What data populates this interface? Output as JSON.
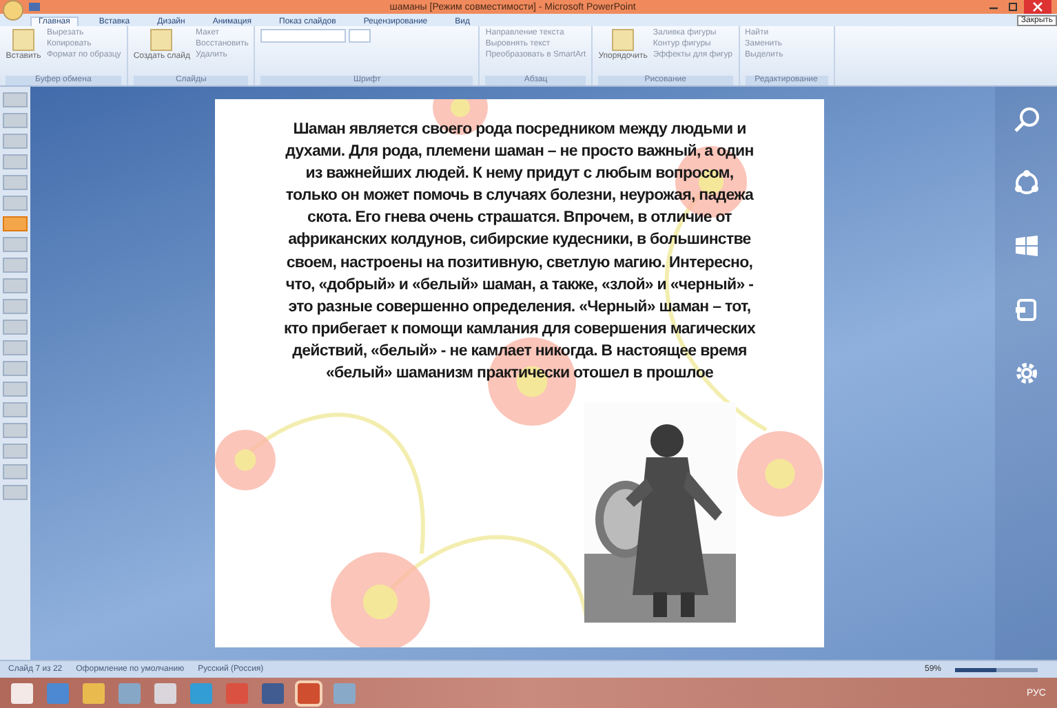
{
  "window": {
    "title": "шаманы [Режим совместимости] - Microsoft PowerPoint",
    "tooltip": "Закрыть"
  },
  "ribbon": {
    "tabs": [
      {
        "label": "Главная",
        "selected": true
      },
      {
        "label": "Вставка",
        "selected": false
      },
      {
        "label": "Дизайн",
        "selected": false
      },
      {
        "label": "Анимация",
        "selected": false
      },
      {
        "label": "Показ слайдов",
        "selected": false
      },
      {
        "label": "Рецензирование",
        "selected": false
      },
      {
        "label": "Вид",
        "selected": false
      }
    ],
    "groups": [
      {
        "name": "Буфер обмена",
        "big": "Вставить",
        "items": [
          "Вырезать",
          "Копировать",
          "Формат по образцу"
        ]
      },
      {
        "name": "Слайды",
        "big": "Создать слайд",
        "items": [
          "Макет",
          "Восстановить",
          "Удалить"
        ]
      },
      {
        "name": "Шрифт"
      },
      {
        "name": "Абзац",
        "items": [
          "Направление текста",
          "Выровнять текст",
          "Преобразовать в SmartArt"
        ]
      },
      {
        "name": "Рисование",
        "big": "Упорядочить",
        "items": [
          "Заливка фигуры",
          "Контур фигуры",
          "Эффекты для фигур"
        ]
      },
      {
        "name": "Редактирование",
        "items": [
          "Найти",
          "Заменить",
          "Выделить"
        ]
      }
    ]
  },
  "thumbnails": [
    {
      "selected": false
    },
    {
      "selected": false
    },
    {
      "selected": false
    },
    {
      "selected": false
    },
    {
      "selected": false
    },
    {
      "selected": false
    },
    {
      "selected": true
    },
    {
      "selected": false
    },
    {
      "selected": false
    },
    {
      "selected": false
    },
    {
      "selected": false
    },
    {
      "selected": false
    },
    {
      "selected": false
    },
    {
      "selected": false
    },
    {
      "selected": false
    },
    {
      "selected": false
    },
    {
      "selected": false
    },
    {
      "selected": false
    },
    {
      "selected": false
    },
    {
      "selected": false
    }
  ],
  "slide": {
    "text": "Шаман является своего рода посредником между людьми и духами. Для рода, племени шаман – не просто важный, а один из важнейших людей. К нему придут с любым вопросом, только он может помочь в случаях болезни, неурожая, падежа скота. Его гнева очень страшатся. Впрочем, в отличие от африканских колдунов, сибирские кудесники, в большинстве своем, настроены на позитивную, светлую магию. Интересно, что, «добрый» и «белый» шаман, а также, «злой» и «черный» - это разные совершенно определения. «Черный» шаман – тот, кто прибегает к помощи камлания для совершения магических действий, «белый» - не камлает никогда. В настоящее время «белый» шаманизм практически отошел в прошлое"
  },
  "charms": [
    {
      "kind": "search"
    },
    {
      "kind": "share"
    },
    {
      "kind": "start"
    },
    {
      "kind": "devices"
    },
    {
      "kind": "settings"
    }
  ],
  "status_bar": {
    "items": [
      "Слайд 7 из 22",
      "Оформление по умолчанию",
      "Русский (Россия)"
    ],
    "zoom": "59%",
    "level": 0.5
  },
  "taskbar": {
    "apps": [
      {
        "kind": "start",
        "selected": false
      },
      {
        "kind": "browser",
        "selected": false
      },
      {
        "kind": "folder",
        "selected": false
      },
      {
        "kind": "app",
        "selected": false
      },
      {
        "kind": "doc",
        "selected": false
      },
      {
        "kind": "skype",
        "selected": false
      },
      {
        "kind": "chrome",
        "selected": false
      },
      {
        "kind": "word",
        "selected": false
      },
      {
        "kind": "powerpoint",
        "selected": true
      },
      {
        "kind": "app",
        "selected": false
      }
    ],
    "lang": "РУС"
  }
}
